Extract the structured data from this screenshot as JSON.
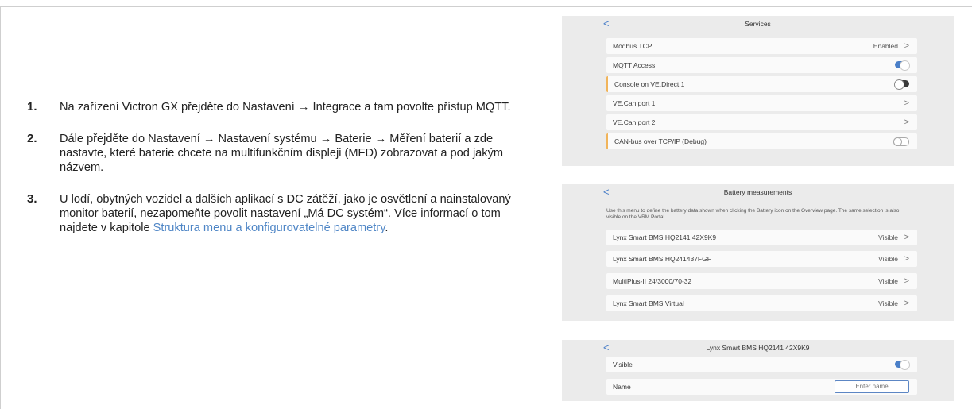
{
  "steps": [
    {
      "num": "1.",
      "text": "Na zařízení Victron GX přejděte do Nastavení → Integrace a tam povolte přístup MQTT."
    },
    {
      "num": "2.",
      "text": "Dále přejděte do Nastavení → Nastavení systému → Baterie → Měření baterií a zde nastavte, které baterie chcete na multifunkčním displeji (MFD) zobrazovat a pod jakým názvem."
    },
    {
      "num": "3.",
      "text": "U lodí, obytných vozidel a dalších aplikací s DC zátěží, jako je osvětlení a nainstalovaný monitor baterií, nezapomeňte povolit nastavení „Má DC systém“. Více informací o tom najdete v kapitole ",
      "link": "Struktura menu a konfigurovatelné parametry",
      "after": "."
    }
  ],
  "services": {
    "back": "<",
    "title": "Services",
    "rows": [
      {
        "label": "Modbus TCP",
        "value": "Enabled",
        "chevron": ">"
      },
      {
        "label": "MQTT Access",
        "toggle": "on"
      },
      {
        "label": "Console on VE.Direct 1",
        "toggle": "off"
      },
      {
        "label": "VE.Can port 1",
        "chevron": ">"
      },
      {
        "label": "VE.Can port 2",
        "chevron": ">"
      },
      {
        "label": "CAN-bus over TCP/IP (Debug)",
        "toggle": "off"
      }
    ]
  },
  "battery": {
    "back": "<",
    "title": "Battery measurements",
    "description": "Use this menu to define the battery data shown when clicking the Battery icon on the Overview page. The same selection is also visible on the VRM Portal.",
    "rows": [
      {
        "label": "Lynx Smart BMS HQ2141 42X9K9",
        "value": "Visible",
        "chevron": ">"
      },
      {
        "label": "Lynx Smart BMS HQ241437FGF",
        "value": "Visible",
        "chevron": ">"
      },
      {
        "label": "MultiPlus-II 24/3000/70-32",
        "value": "Visible",
        "chevron": ">"
      },
      {
        "label": "Lynx Smart BMS Virtual",
        "value": "Visible",
        "chevron": ">"
      }
    ]
  },
  "detail": {
    "back": "<",
    "title": "Lynx Smart BMS HQ2141 42X9K9",
    "visible_label": "Visible",
    "visible_toggle": "on",
    "name_label": "Name",
    "name_placeholder": "Enter name"
  },
  "colors": {
    "accent": "#4a7fc8",
    "link": "#4f86c6",
    "highlight_bar": "#f1b45a",
    "panel_bg": "#ebebeb"
  }
}
